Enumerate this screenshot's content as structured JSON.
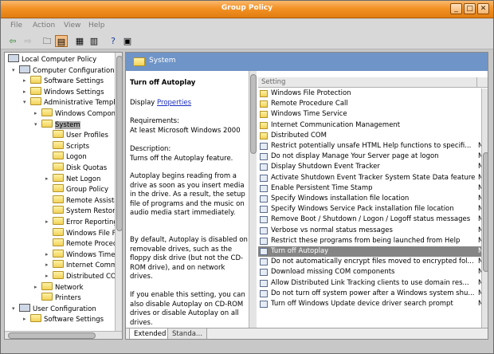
{
  "window": {
    "title": "Group Policy"
  },
  "titlebar_buttons": {
    "minimize": "_",
    "maximize": "□",
    "close": "✕"
  },
  "menu": [
    "File",
    "Action",
    "View",
    "Help"
  ],
  "toolbar_icons": [
    "back-arrow-icon",
    "forward-arrow-icon",
    "up-folder-icon",
    "show-hide-tree-icon",
    "properties-icon",
    "export-list-icon",
    "help-icon",
    "toggle-pane-icon"
  ],
  "tree": [
    {
      "label": "Local Computer Policy",
      "level": 0,
      "icon": "pc",
      "exp": ""
    },
    {
      "label": "Computer Configuration",
      "level": 1,
      "icon": "pc",
      "exp": "▾"
    },
    {
      "label": "Software Settings",
      "level": 2,
      "icon": "folder",
      "exp": "▸"
    },
    {
      "label": "Windows Settings",
      "level": 2,
      "icon": "folder",
      "exp": "▸"
    },
    {
      "label": "Administrative Templates",
      "level": 2,
      "icon": "folder",
      "exp": "▾"
    },
    {
      "label": "Windows Components",
      "level": 3,
      "icon": "folder",
      "exp": "▸"
    },
    {
      "label": "System",
      "level": 3,
      "icon": "folder",
      "exp": "▾",
      "selected": true
    },
    {
      "label": "User Profiles",
      "level": 4,
      "icon": "folder",
      "exp": ""
    },
    {
      "label": "Scripts",
      "level": 4,
      "icon": "folder",
      "exp": ""
    },
    {
      "label": "Logon",
      "level": 4,
      "icon": "folder",
      "exp": ""
    },
    {
      "label": "Disk Quotas",
      "level": 4,
      "icon": "folder",
      "exp": ""
    },
    {
      "label": "Net Logon",
      "level": 4,
      "icon": "folder",
      "exp": "▸"
    },
    {
      "label": "Group Policy",
      "level": 4,
      "icon": "folder",
      "exp": ""
    },
    {
      "label": "Remote Assistance",
      "level": 4,
      "icon": "folder",
      "exp": ""
    },
    {
      "label": "System Restore",
      "level": 4,
      "icon": "folder",
      "exp": ""
    },
    {
      "label": "Error Reporting",
      "level": 4,
      "icon": "folder",
      "exp": "▸"
    },
    {
      "label": "Windows File Protection",
      "level": 4,
      "icon": "folder",
      "exp": ""
    },
    {
      "label": "Remote Procedure Call",
      "level": 4,
      "icon": "folder",
      "exp": ""
    },
    {
      "label": "Windows Time Service",
      "level": 4,
      "icon": "folder",
      "exp": "▸"
    },
    {
      "label": "Internet Communication Management",
      "level": 4,
      "icon": "folder",
      "exp": "▸"
    },
    {
      "label": "Distributed COM",
      "level": 4,
      "icon": "folder",
      "exp": "▸"
    },
    {
      "label": "Network",
      "level": 3,
      "icon": "folder",
      "exp": "▸"
    },
    {
      "label": "Printers",
      "level": 3,
      "icon": "folder",
      "exp": ""
    },
    {
      "label": "User Configuration",
      "level": 1,
      "icon": "pc",
      "exp": "▾"
    },
    {
      "label": "Software Settings",
      "level": 2,
      "icon": "folder",
      "exp": "▸"
    }
  ],
  "header": {
    "title": "System"
  },
  "description": {
    "title": "Turn off Autoplay",
    "display_prefix": "Display ",
    "display_link": "Properties",
    "requirements_label": "Requirements:",
    "requirements_value": "At least Microsoft Windows 2000",
    "description_label": "Description:",
    "description_value": "Turns off the Autoplay feature.",
    "para1": "Autoplay begins reading from a drive as soon as you insert media in the drive. As a result, the setup file of programs and the music on audio media start immediately.",
    "para2": "By default, Autoplay is disabled on removable drives, such as the floppy disk drive (but not the CD-ROM drive), and on network drives.",
    "para3": "If you enable this setting, you can also disable Autoplay on CD-ROM drives or disable Autoplay on all drives."
  },
  "list": {
    "column_setting": "Setting",
    "rows": [
      {
        "type": "folder",
        "label": "Windows File Protection",
        "state": ""
      },
      {
        "type": "folder",
        "label": "Remote Procedure Call",
        "state": ""
      },
      {
        "type": "folder",
        "label": "Windows Time Service",
        "state": ""
      },
      {
        "type": "folder",
        "label": "Internet Communication Management",
        "state": ""
      },
      {
        "type": "folder",
        "label": "Distributed COM",
        "state": ""
      },
      {
        "type": "setting",
        "label": "Restrict potentially unsafe HTML Help functions to specifi...",
        "state": "N"
      },
      {
        "type": "setting",
        "label": "Do not display Manage Your Server page at logon",
        "state": "N"
      },
      {
        "type": "setting",
        "label": "Display Shutdown Event Tracker",
        "state": "N"
      },
      {
        "type": "setting",
        "label": "Activate Shutdown Event Tracker System State Data feature",
        "state": "N"
      },
      {
        "type": "setting",
        "label": "Enable Persistent Time Stamp",
        "state": "N"
      },
      {
        "type": "setting",
        "label": "Specify Windows installation file location",
        "state": "N"
      },
      {
        "type": "setting",
        "label": "Specify Windows Service Pack installation file location",
        "state": "N"
      },
      {
        "type": "setting",
        "label": "Remove Boot / Shutdown / Logon / Logoff status messages",
        "state": "N"
      },
      {
        "type": "setting",
        "label": "Verbose vs normal status messages",
        "state": "N"
      },
      {
        "type": "setting",
        "label": "Restrict these programs from being launched from Help",
        "state": "N"
      },
      {
        "type": "setting",
        "label": "Turn off Autoplay",
        "state": "N",
        "selected": true
      },
      {
        "type": "setting",
        "label": "Do not automatically encrypt files moved to encrypted fol...",
        "state": "N"
      },
      {
        "type": "setting",
        "label": "Download missing COM components",
        "state": "N"
      },
      {
        "type": "setting",
        "label": "Allow Distributed Link Tracking clients to use domain res...",
        "state": "N"
      },
      {
        "type": "setting",
        "label": "Do not turn off system power after a Windows system shu...",
        "state": "N"
      },
      {
        "type": "setting",
        "label": "Turn off Windows Update device driver search prompt",
        "state": "N"
      }
    ]
  },
  "tabs": [
    "Extended",
    "Standa..."
  ],
  "colors": {
    "titlebar": "#f39226",
    "header_band": "#6f94c7",
    "selection": "#858585"
  }
}
